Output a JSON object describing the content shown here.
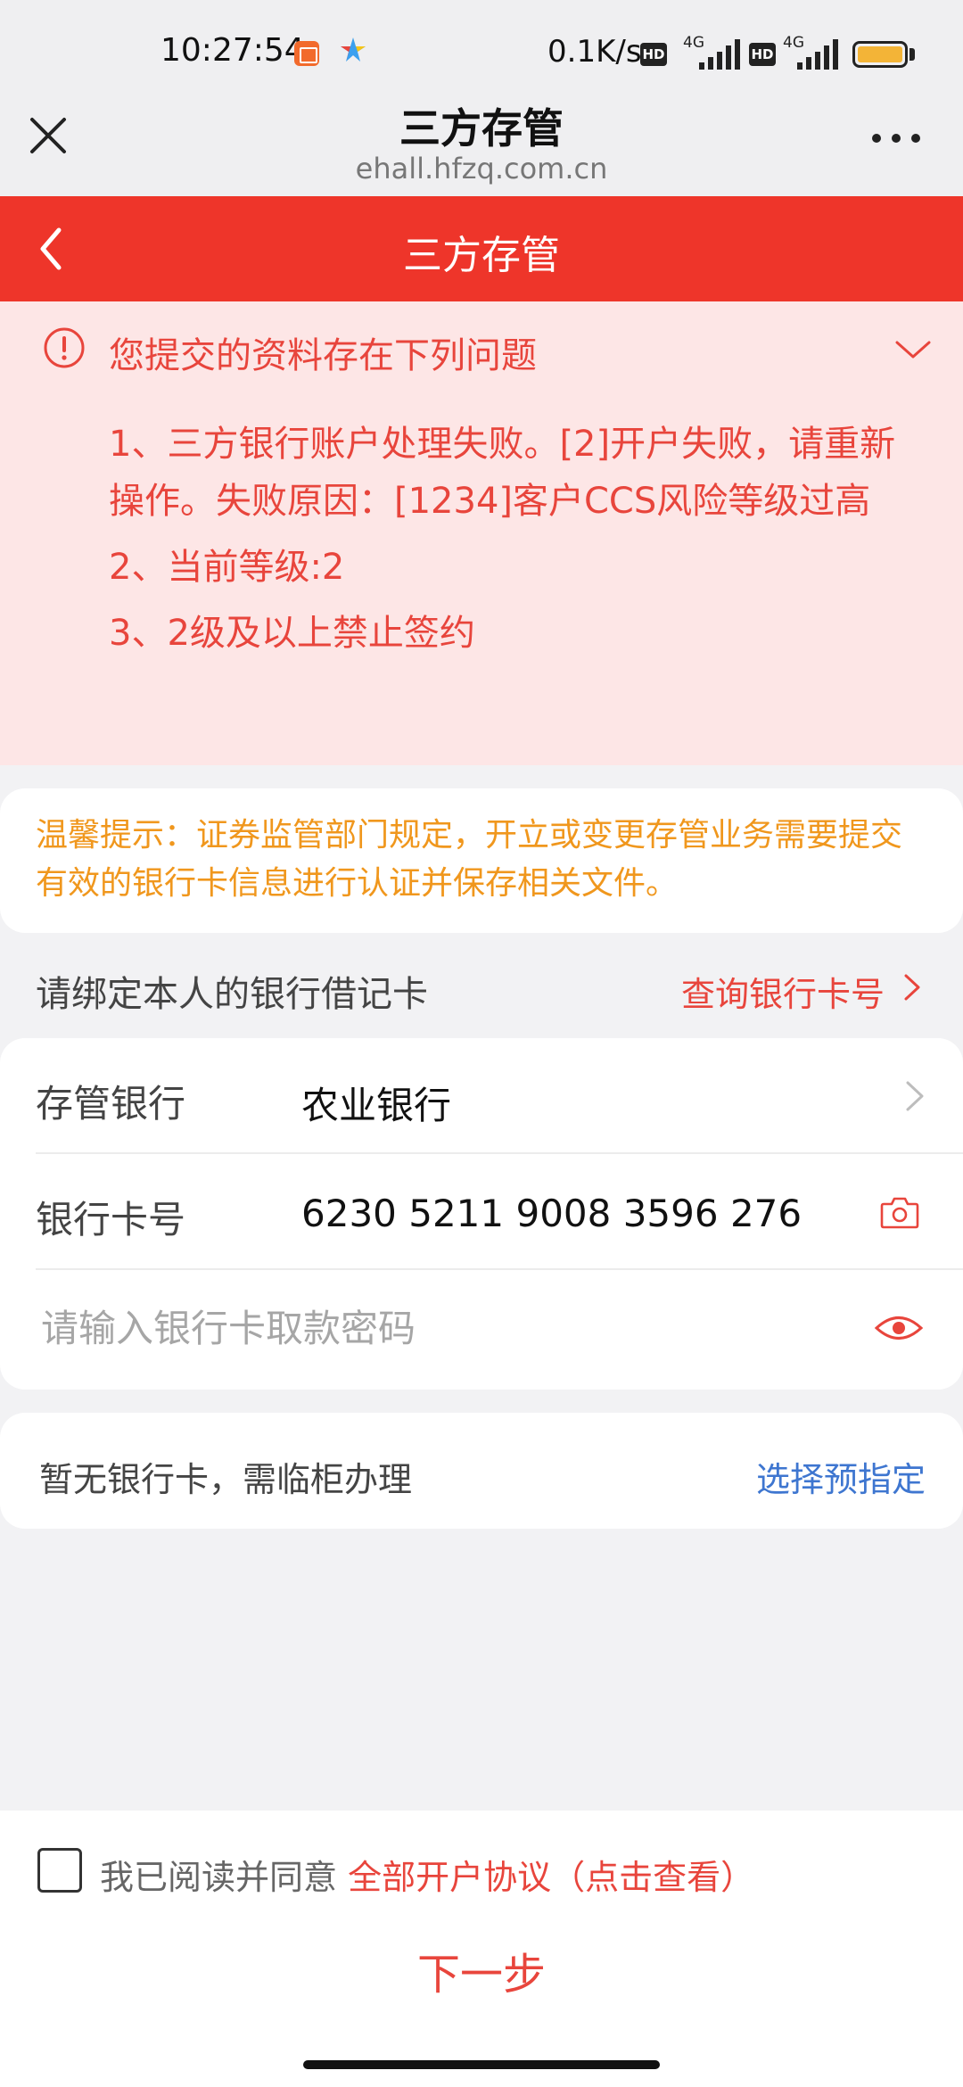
{
  "status_bar": {
    "time": "10:27:54",
    "speed": "0.1K/s",
    "hd_label": "HD",
    "network_label": "4G",
    "battery_color": "#f3b437"
  },
  "browser": {
    "title": "三方存管",
    "url": "ehall.hfzq.com.cn"
  },
  "page": {
    "title": "三方存管",
    "accent_color": "#ee352a"
  },
  "error_panel": {
    "heading": "您提交的资料存在下列问题",
    "items": [
      "1、三方银行账户处理失败。[2]开户失败，请重新操作。失败原因：[1234]客户CCS风险等级过高",
      "2、当前等级:2",
      "3、2级及以上禁止签约"
    ]
  },
  "tip": {
    "text": "温馨提示：证券监管部门规定，开立或变更存管业务需要提交有效的银行卡信息进行认证并保存相关文件。"
  },
  "bind": {
    "label": "请绑定本人的银行借记卡",
    "query_link": "查询银行卡号"
  },
  "form": {
    "bank_label": "存管银行",
    "bank_value": "农业银行",
    "card_label": "银行卡号",
    "card_value": "6230 5211 9008 3596 276",
    "password_placeholder": "请输入银行卡取款密码"
  },
  "no_card": {
    "label": "暂无银行卡，需临柜办理",
    "link": "选择预指定"
  },
  "agreement": {
    "prefix": "我已阅读并同意",
    "link": "全部开户协议（点击查看）",
    "checked": false
  },
  "next_button": "下一步"
}
